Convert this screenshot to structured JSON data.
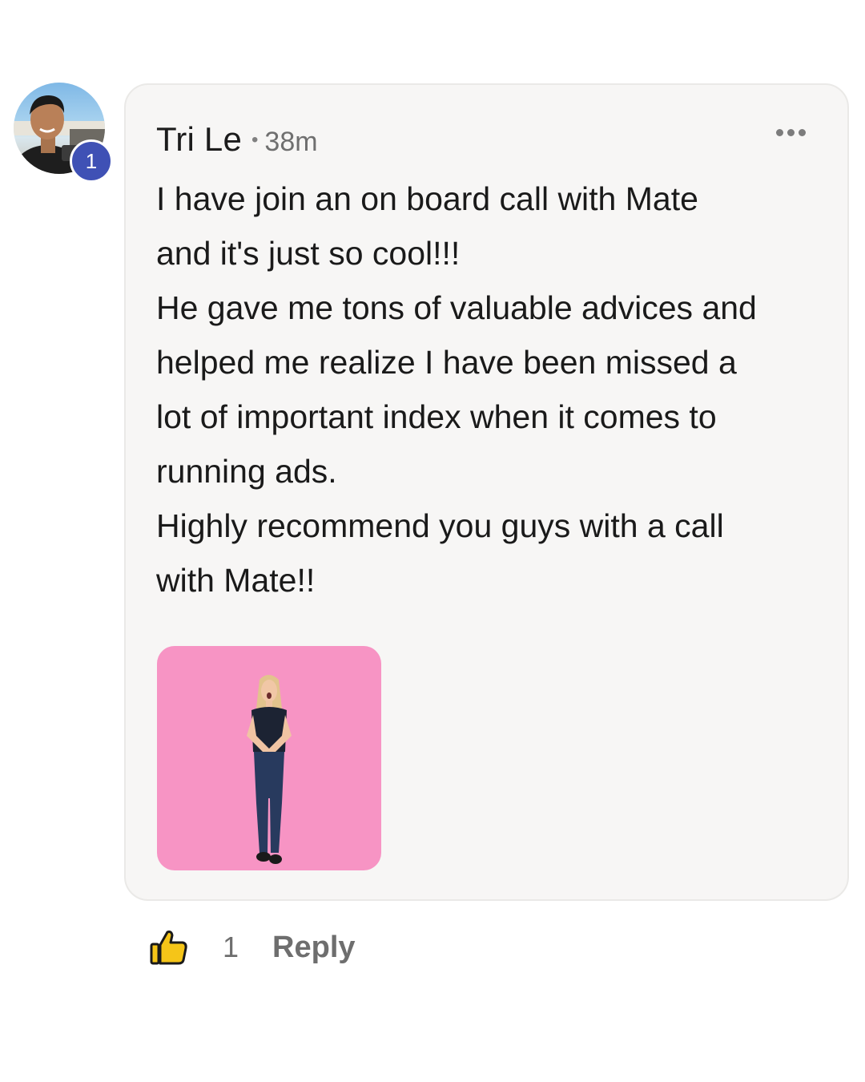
{
  "comment": {
    "author": "Tri Le",
    "separator": "•",
    "time": "38m",
    "level_badge": "1",
    "more_icon": "more-horizontal-icon",
    "lines": [
      "I have join an on board call with Mate",
      "and it's just so cool!!!",
      "He gave me tons of valuable advices and",
      "helped me realize I have been missed a",
      "lot of important index when it comes to",
      "running ads.",
      "Highly recommend you guys with a call",
      "with Mate!!"
    ],
    "gif_background": "#f794c4"
  },
  "actions": {
    "like_icon": "thumbs-up-icon",
    "like_count": "1",
    "reply_label": "Reply"
  },
  "colors": {
    "bubble": "#f7f6f5",
    "badge": "#3f51b5",
    "like_icon": "#f5c518"
  }
}
